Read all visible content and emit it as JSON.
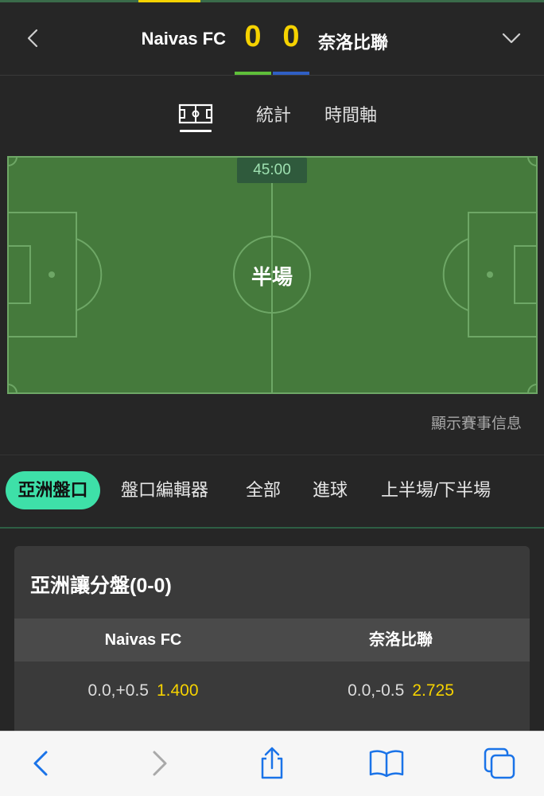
{
  "header": {
    "home_team": "Naivas FC",
    "away_team": "奈洛比聯",
    "home_score": "0",
    "away_score": "0",
    "home_color": "#5fbf3a",
    "away_color": "#2f5fc4",
    "score_color": "#f5d200"
  },
  "view_tabs": {
    "pitch_icon": "pitch-icon",
    "stats": "統計",
    "timeline": "時間軸"
  },
  "pitch": {
    "time": "45:00",
    "status": "半場",
    "show_info": "顯示賽事信息"
  },
  "market_tabs": {
    "items": [
      "亞洲盤口",
      "盤口編輯器",
      "全部",
      "進球",
      "上半場/下半場"
    ],
    "active_index": 0,
    "active_color": "#3ee0a8"
  },
  "odds_card": {
    "title": "亞洲讓分盤(0-0)",
    "columns": [
      "Naivas FC",
      "奈洛比聯"
    ],
    "rows": [
      {
        "home_line": "0.0,+0.5",
        "home_price": "1.400",
        "away_line": "0.0,-0.5",
        "away_price": "2.725"
      }
    ]
  },
  "toolbar": {
    "icons": [
      "back-icon",
      "forward-icon",
      "share-icon",
      "bookmarks-icon",
      "tabs-icon"
    ],
    "accent": "#1a73e8"
  }
}
